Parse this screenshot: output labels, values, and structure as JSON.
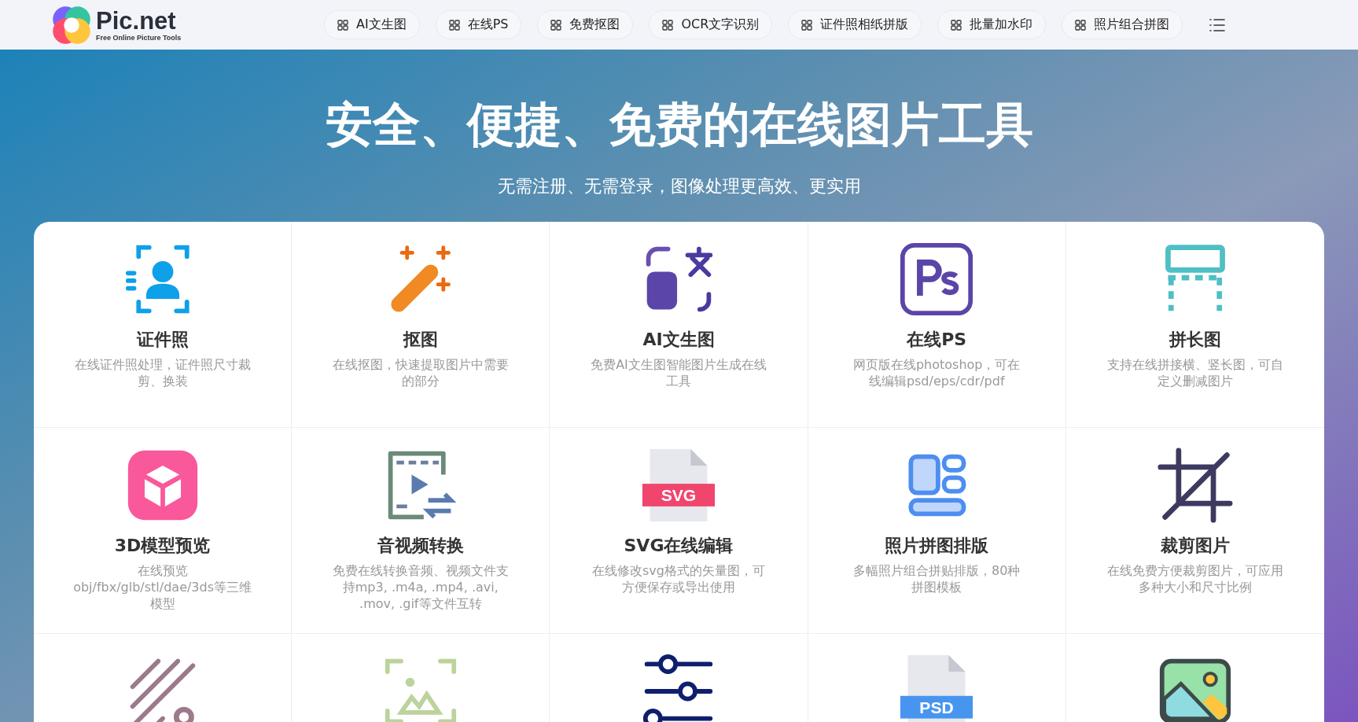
{
  "logo": {
    "name": "Pic.net",
    "tagline": "Free Online Picture Tools"
  },
  "nav": [
    "AI文生图",
    "在线PS",
    "免费抠图",
    "OCR文字识别",
    "证件照相纸拼版",
    "批量加水印",
    "照片组合拼图"
  ],
  "hero": {
    "title": "安全、便捷、免费的在线图片工具",
    "subtitle": "无需注册、无需登录，图像处理更高效、更实用"
  },
  "tools": [
    {
      "title": "证件照",
      "description": "在线证件照处理，证件照尺寸裁剪、换装"
    },
    {
      "title": "抠图",
      "description": "在线抠图，快速提取图片中需要的部分"
    },
    {
      "title": "AI文生图",
      "description": "免费AI文生图智能图片生成在线工具"
    },
    {
      "title": "在线PS",
      "description": "网页版在线photoshop，可在线编辑psd/eps/cdr/pdf"
    },
    {
      "title": "拼长图",
      "description": "支持在线拼接横、竖长图，可自定义删减图片"
    },
    {
      "title": "3D模型预览",
      "description": "在线预览obj/fbx/glb/stl/dae/3ds等三维模型"
    },
    {
      "title": "音视频转换",
      "description": "免费在线转换音频、视频文件支持mp3, .m4a, .mp4, .avi, .mov, .gif等文件互转"
    },
    {
      "title": "SVG在线编辑",
      "description": "在线修改svg格式的矢量图，可方便保存或导出使用",
      "badge": "SVG"
    },
    {
      "title": "照片拼图排版",
      "description": "多幅照片组合拼贴排版，80种拼图模板"
    },
    {
      "title": "裁剪图片",
      "description": "在线免费方便裁剪图片，可应用多种大小和尺寸比例"
    }
  ],
  "psd_file_badge": "PSD"
}
